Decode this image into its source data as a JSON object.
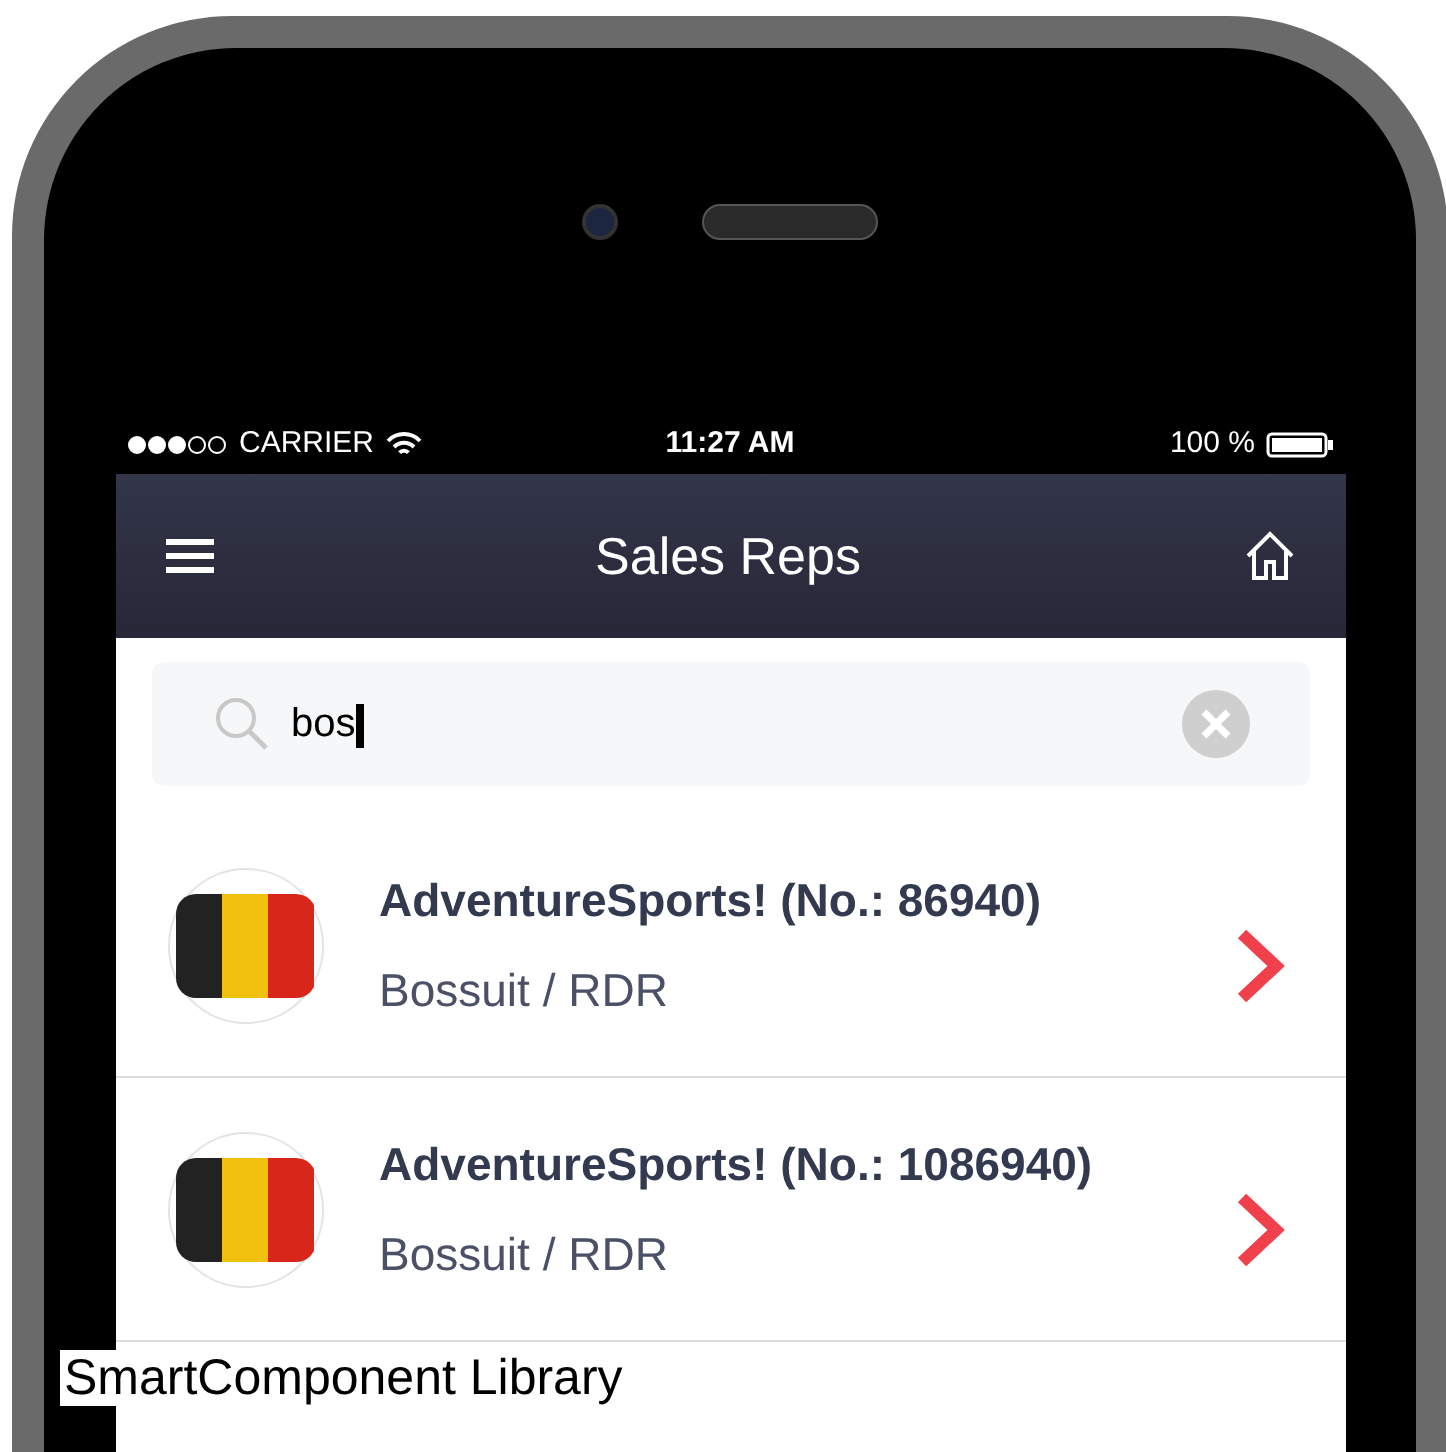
{
  "status_bar": {
    "carrier": "CARRIER",
    "time": "11:27 AM",
    "battery": "100 %"
  },
  "nav_bar": {
    "title": "Sales Reps"
  },
  "search": {
    "value": "bos"
  },
  "reps": [
    {
      "name": "AdventureSports! (No.: 86940)",
      "location": "Bossuit / RDR"
    },
    {
      "name": "AdventureSports! (No.: 1086940)",
      "location": "Bossuit / RDR"
    }
  ],
  "caption": "SmartComponent Library"
}
